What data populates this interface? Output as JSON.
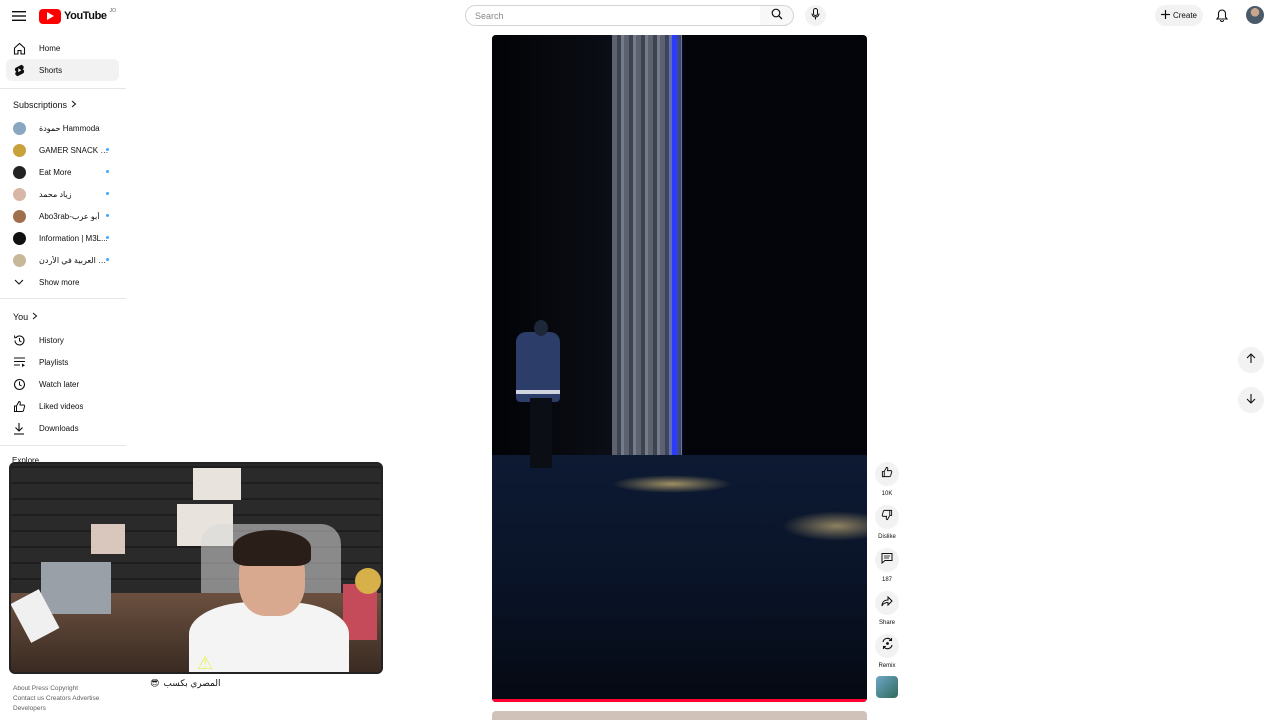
{
  "header": {
    "logo_text": "YouTube",
    "country_code": "JO",
    "search_placeholder": "Search",
    "create_label": "Create"
  },
  "sidebar": {
    "main": [
      {
        "label": "Home",
        "icon": "home-icon"
      },
      {
        "label": "Shorts",
        "icon": "shorts-icon",
        "active": true
      }
    ],
    "subscriptions_title": "Subscriptions",
    "subscriptions": [
      {
        "label": "حمودة Hammoda",
        "color": "#8aa7c2",
        "dot": false
      },
      {
        "label": "GAMER SNACK | ...",
        "color": "#c9a13b",
        "dot": true
      },
      {
        "label": "Eat More",
        "color": "#222222",
        "dot": true
      },
      {
        "label": "زياد محمد",
        "color": "#d8b7a6",
        "dot": true
      },
      {
        "label": "Abo3rab-أبو عرب",
        "color": "#a0704e",
        "dot": true
      },
      {
        "label": "Information | M3L...",
        "color": "#111111",
        "dot": true
      },
      {
        "label": "مرجعية العربية في الأردن",
        "color": "#c8b89a",
        "dot": true
      }
    ],
    "show_more": "Show more",
    "you_title": "You",
    "you_items": [
      {
        "label": "History",
        "icon": "history-icon"
      },
      {
        "label": "Playlists",
        "icon": "playlists-icon"
      },
      {
        "label": "Watch later",
        "icon": "watch-later-icon"
      },
      {
        "label": "Liked videos",
        "icon": "liked-videos-icon"
      },
      {
        "label": "Downloads",
        "icon": "downloads-icon"
      }
    ],
    "explore_title": "Explore",
    "footer_line1": "About  Press  Copyright",
    "footer_line2": "Contact us  Creators  Advertise",
    "footer_line3": "Developers"
  },
  "webcam": {
    "caption": "المصري بكسب"
  },
  "actions": {
    "like_count": "10K",
    "dislike_label": "Dislike",
    "comment_count": "187",
    "share_label": "Share",
    "remix_label": "Remix"
  },
  "colors": {
    "brand_red": "#ff0000",
    "progress": "#ff0033",
    "stage_blue": "#2b3cff"
  }
}
